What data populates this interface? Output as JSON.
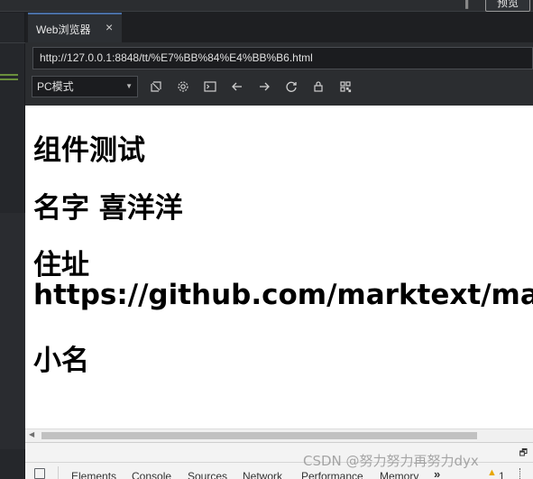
{
  "window": {
    "preview_button": "预览"
  },
  "browser": {
    "tab_title": "Web浏览器",
    "tab_close": "×",
    "url": "http://127.0.0.1:8848/tt/%E7%BB%84%E4%BB%B6.html",
    "mode": "PC模式",
    "toolbar_icons": [
      "screenshot-icon",
      "settings-icon",
      "terminal-icon",
      "back-arrow-icon",
      "forward-arrow-icon",
      "refresh-icon",
      "lock-icon",
      "qrcode-icon"
    ]
  },
  "page": {
    "heading1": "组件测试",
    "heading2": "名字 喜洋洋",
    "heading3_line1": "住址",
    "heading3_line2": "https://github.com/marktext/marktext",
    "heading4": "小名"
  },
  "devtools": {
    "tabs": [
      "Elements",
      "Console",
      "Sources",
      "Network",
      "Performance",
      "Memory"
    ],
    "more": "»",
    "warning_count": "1"
  },
  "watermark": "CSDN @努力努力再努力dyx"
}
